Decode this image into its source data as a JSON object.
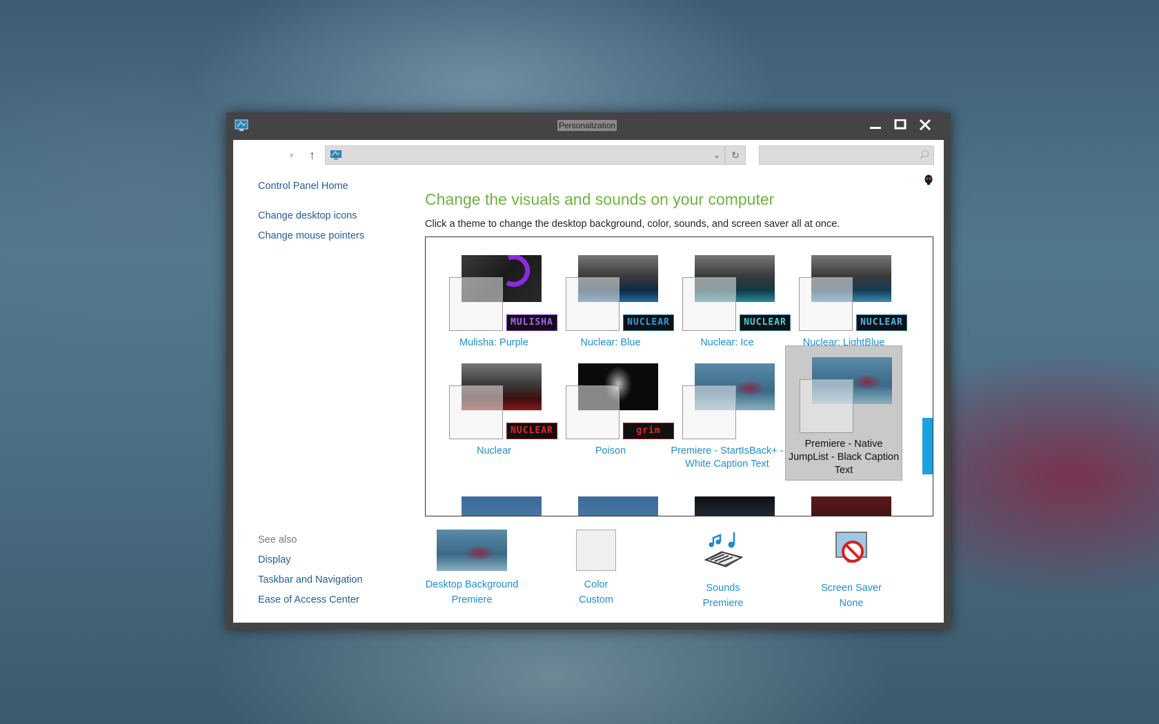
{
  "window": {
    "title": "Personalization"
  },
  "sidebar": {
    "home_link": "Control Panel Home",
    "links": [
      "Change desktop icons",
      "Change mouse pointers"
    ],
    "see_also_heading": "See also",
    "see_also": [
      "Display",
      "Taskbar and Navigation",
      "Ease of Access Center"
    ]
  },
  "main": {
    "heading": "Change the visuals and sounds on your computer",
    "subheading": "Click a theme to change the desktop background, color, sounds, and screen saver all at once."
  },
  "themes": [
    {
      "label": "Mulisha: Purple",
      "badge": "MULISHA",
      "badge_color": "#b05cff"
    },
    {
      "label": "Nuclear: Blue",
      "badge": "NUCLEAR",
      "badge_color": "#2a9fe0"
    },
    {
      "label": "Nuclear: Ice",
      "badge": "NUCLEAR",
      "badge_color": "#3fd6e0"
    },
    {
      "label": "Nuclear: LightBlue",
      "badge": "NUCLEAR",
      "badge_color": "#4cb8f0"
    },
    {
      "label": "Nuclear",
      "badge": "NUCLEAR",
      "badge_color": "#e02a2a"
    },
    {
      "label": "Poison",
      "badge": "grim",
      "badge_color": "#e02a2a"
    },
    {
      "label": "Premiere - StartIsBack+ - White Caption Text"
    },
    {
      "label": "Premiere - Native JumpList - Black Caption Text",
      "selected": true
    }
  ],
  "bottom": [
    {
      "label": "Desktop Background",
      "value": "Premiere"
    },
    {
      "label": "Color",
      "value": "Custom"
    },
    {
      "label": "Sounds",
      "value": "Premiere"
    },
    {
      "label": "Screen Saver",
      "value": "None"
    }
  ],
  "colors": {
    "accent": "#1ba1e2",
    "heading": "#6db33f",
    "link": "#1e8fd0"
  }
}
